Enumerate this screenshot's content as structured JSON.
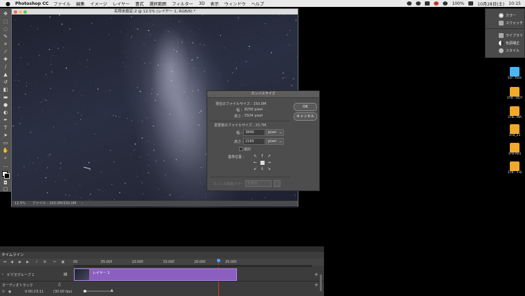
{
  "menubar": {
    "app": "Photoshop CC",
    "items": [
      "ファイル",
      "編集",
      "イメージ",
      "レイヤー",
      "書式",
      "選択範囲",
      "フィルター",
      "3D",
      "表示",
      "ウィンドウ",
      "ヘルプ"
    ],
    "battery": "100%",
    "date": "10月28日(土)",
    "time": "10:15"
  },
  "document": {
    "title": "名称未設定-2 @ 12.5% (レイヤー 1, RGB/8) *",
    "zoom": "12.5%",
    "file_info": "ファイル : 150.0M/150.0M"
  },
  "dialog": {
    "title": "カンバスサイズ",
    "current_size": "現在のファイルサイズ : 150.0M",
    "current_width_label": "幅 :",
    "current_width": "8256 pixel",
    "current_height_label": "高さ :",
    "current_height": "5504 pixel",
    "new_size": "変更後のファイルサイズ : 23.7M",
    "width_label": "幅 :",
    "width_value": "3840",
    "height_label": "高さ :",
    "height_value": "2160",
    "unit": "pixel",
    "relative_label": "相対",
    "anchor_label": "基準位置 :",
    "ext_color_label": "カンバス拡張カラー :",
    "ext_color_value": "背景色",
    "ok": "OK",
    "cancel": "キャンセル"
  },
  "panels": [
    "カラー",
    "スウォッチ",
    "ライブラリ",
    "色調補正",
    "スタイル"
  ],
  "desktop_icons": [
    {
      "label": "Scr...ture",
      "color": "#49b7f2"
    },
    {
      "label": "3TB...OOT",
      "color": "#f0a92a"
    },
    {
      "label": "3TB...MA",
      "color": "#f0a92a"
    },
    {
      "label": "3TB_23",
      "color": "#f0a92a"
    },
    {
      "label": "3TB-A01",
      "color": "#f0a92a"
    },
    {
      "label": "3TB...1-B",
      "color": "#f0a92a"
    }
  ],
  "timeline": {
    "tab": "タイムライン",
    "ruler": [
      "00",
      "05:00f",
      "10:00f",
      "15:00f",
      "20:00f",
      "25:00f"
    ],
    "video_group": "ビデオグループ 1",
    "layer": "レイヤー 1",
    "audio_track": "オーディオトラック",
    "timecode": "0:00:23:11",
    "fps": "(30.00 fps)"
  }
}
